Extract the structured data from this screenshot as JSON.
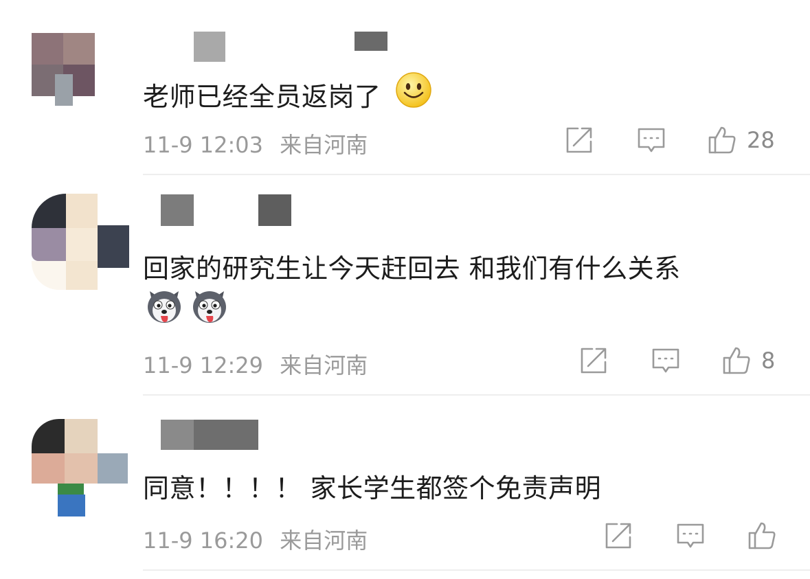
{
  "comments": [
    {
      "text": "老师已经全员返岗了",
      "time": "11-9 12:03",
      "location": "来自河南",
      "likes": "28",
      "emoji": "smile-emoji"
    },
    {
      "text": "回家的研究生让今天赶回去 和我们有什么关系",
      "time": "11-9 12:29",
      "location": "来自河南",
      "likes": "8",
      "emoji": "husky-emoji"
    },
    {
      "text": "同意！！！！ 家长学生都签个免责声明",
      "time": "11-9 16:20",
      "location": "来自河南",
      "likes": "",
      "emoji": ""
    }
  ],
  "icons": {
    "share": "share-icon",
    "reply": "comment-icon",
    "like": "thumbs-up-icon"
  },
  "colors": {
    "text": "#1c1c1c",
    "meta": "#9a9a9a",
    "icon": "#9a9a9a",
    "divider": "#eeeeee"
  }
}
